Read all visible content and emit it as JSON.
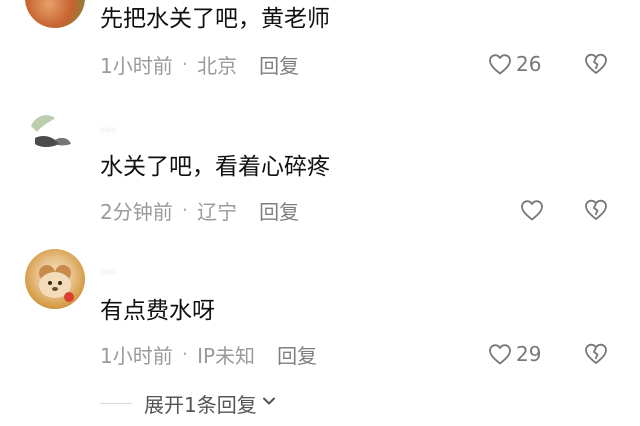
{
  "comments": [
    {
      "username": "",
      "text": "先把水关了吧，黄老师",
      "time": "1小时前",
      "location": "北京",
      "reply_label": "回复",
      "likes": "26",
      "like_icon": "heart-outline-icon",
      "dislike_icon": "broken-heart-icon"
    },
    {
      "username": "…",
      "text": "水关了吧，看着心碎疼",
      "time": "2分钟前",
      "location": "辽宁",
      "reply_label": "回复",
      "likes": "",
      "like_icon": "heart-outline-icon",
      "dislike_icon": "broken-heart-icon"
    },
    {
      "username": "…",
      "text": "有点费水呀",
      "time": "1小时前",
      "location": "IP未知",
      "reply_label": "回复",
      "likes": "29",
      "like_icon": "heart-outline-icon",
      "dislike_icon": "broken-heart-icon"
    }
  ],
  "expand_replies": {
    "label": "展开1条回复",
    "icon": "chevron-down-icon"
  },
  "colors": {
    "text": "#111111",
    "meta": "#9a9a9a",
    "icon": "#777777"
  }
}
